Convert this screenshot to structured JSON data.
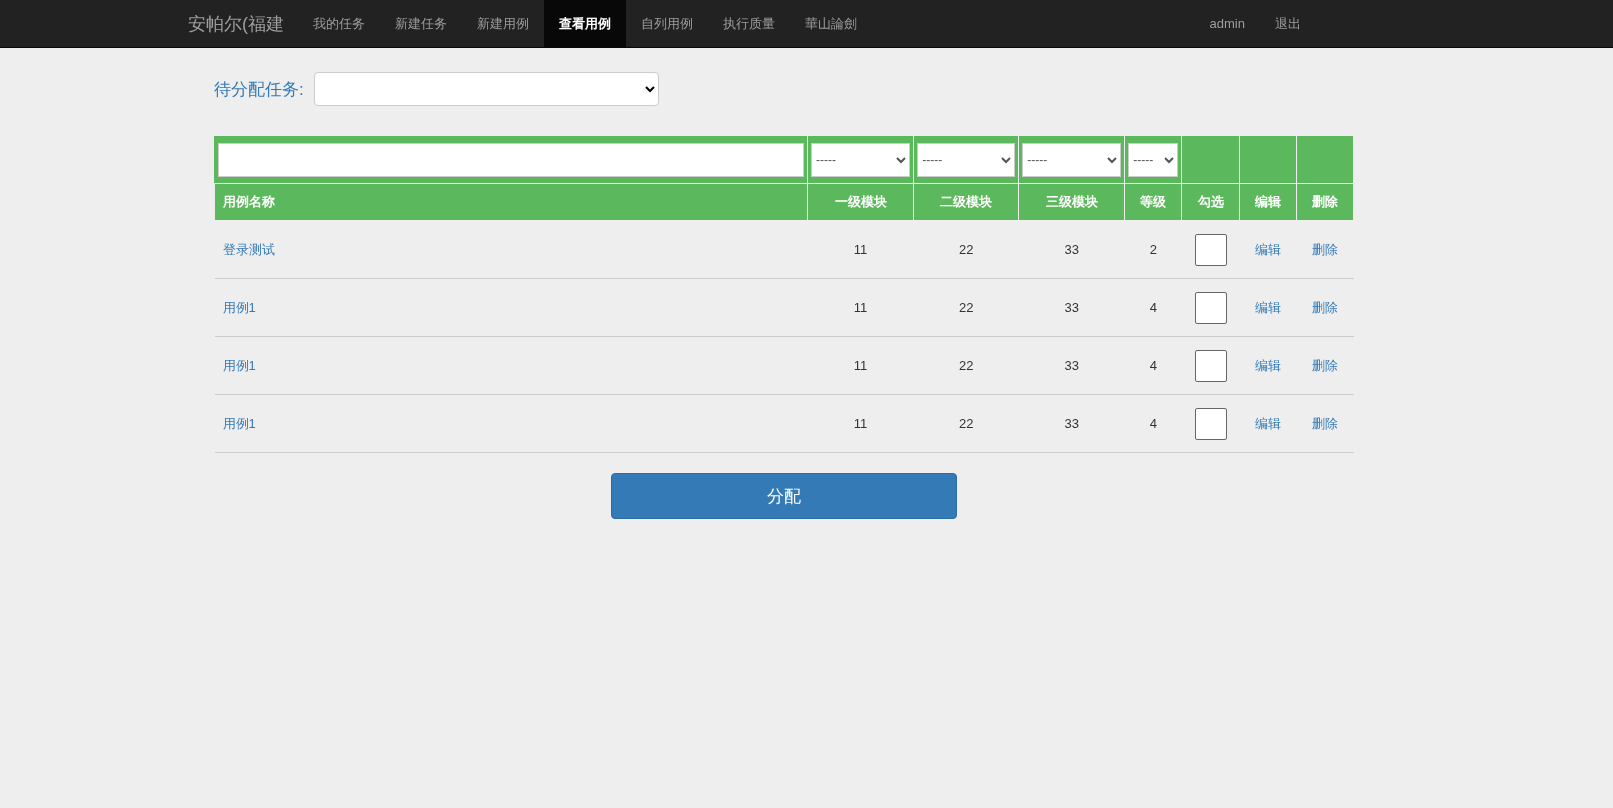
{
  "navbar": {
    "brand": "安帕尔(福建",
    "items": [
      {
        "label": "我的任务",
        "selected": false
      },
      {
        "label": "新建任务",
        "selected": false
      },
      {
        "label": "新建用例",
        "selected": false
      },
      {
        "label": "查看用例",
        "selected": true
      },
      {
        "label": "自列用例",
        "selected": false
      },
      {
        "label": "执行质量",
        "selected": false
      },
      {
        "label": "華山論劍",
        "selected": false
      }
    ],
    "right_items": [
      "admin",
      "退出"
    ]
  },
  "task_select": {
    "label": "待分配任务:"
  },
  "table": {
    "filters": [
      {
        "kind": "text"
      },
      {
        "kind": "select",
        "value": "-----"
      },
      {
        "kind": "select",
        "value": "-----"
      },
      {
        "kind": "select",
        "value": "-----"
      },
      {
        "kind": "select",
        "value": "-----"
      },
      {
        "kind": "none"
      },
      {
        "kind": "none"
      },
      {
        "kind": "none"
      }
    ],
    "columns": [
      "用例名称",
      "一级模块",
      "二级模块",
      "三级模块",
      "等级",
      "勾选",
      "编辑",
      "删除"
    ],
    "rows": [
      {
        "name": "登录测试",
        "module_1": "11",
        "module_2": "22",
        "module_3": "33",
        "level": "2",
        "checked": false,
        "edit": "编辑",
        "delete": "删除"
      },
      {
        "name": "用例1",
        "module_1": "11",
        "module_2": "22",
        "module_3": "33",
        "level": "4",
        "checked": false,
        "edit": "编辑",
        "delete": "删除"
      },
      {
        "name": "用例1",
        "module_1": "11",
        "module_2": "22",
        "module_3": "33",
        "level": "4",
        "checked": false,
        "edit": "编辑",
        "delete": "删除"
      },
      {
        "name": "用例1",
        "module_1": "11",
        "module_2": "22",
        "module_3": "33",
        "level": "4",
        "checked": false,
        "edit": "编辑",
        "delete": "删除"
      }
    ]
  },
  "assign_button": "分配"
}
